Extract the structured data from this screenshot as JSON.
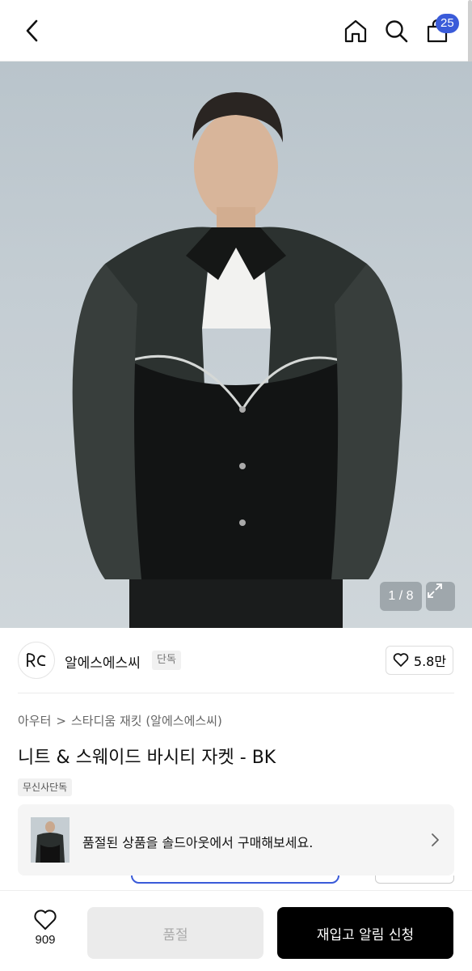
{
  "header": {
    "back_icon": "chevron-left-icon",
    "home_icon": "home-icon",
    "search_icon": "search-icon",
    "cart_icon": "shopping-bag-icon",
    "cart_count": "25",
    "accent_color": "#3a5bd9"
  },
  "gallery": {
    "current": 1,
    "total": 8,
    "counter_text": "1 / 8",
    "expand_icon": "expand-icon"
  },
  "brand": {
    "name": "알에스에스씨",
    "tag": "단독",
    "likes": "5.8만",
    "heart_icon": "heart-icon"
  },
  "breadcrumb": {
    "category": "아우터",
    "separator": ">",
    "subcategory": "스타디움 재킷 (알에스에스씨)"
  },
  "product": {
    "title": "니트 & 스웨이드 바시티 자켓 - BK",
    "exclusive_tag": "무신사단독"
  },
  "soldout_banner": {
    "text": "품절된 상품을 솔드아웃에서 구매해보세요.",
    "arrow_icon": "chevron-right-icon"
  },
  "bottom_bar": {
    "wish_icon": "heart-icon",
    "wish_count": "909",
    "soldout_label": "품절",
    "restock_label": "재입고 알림 신청"
  }
}
